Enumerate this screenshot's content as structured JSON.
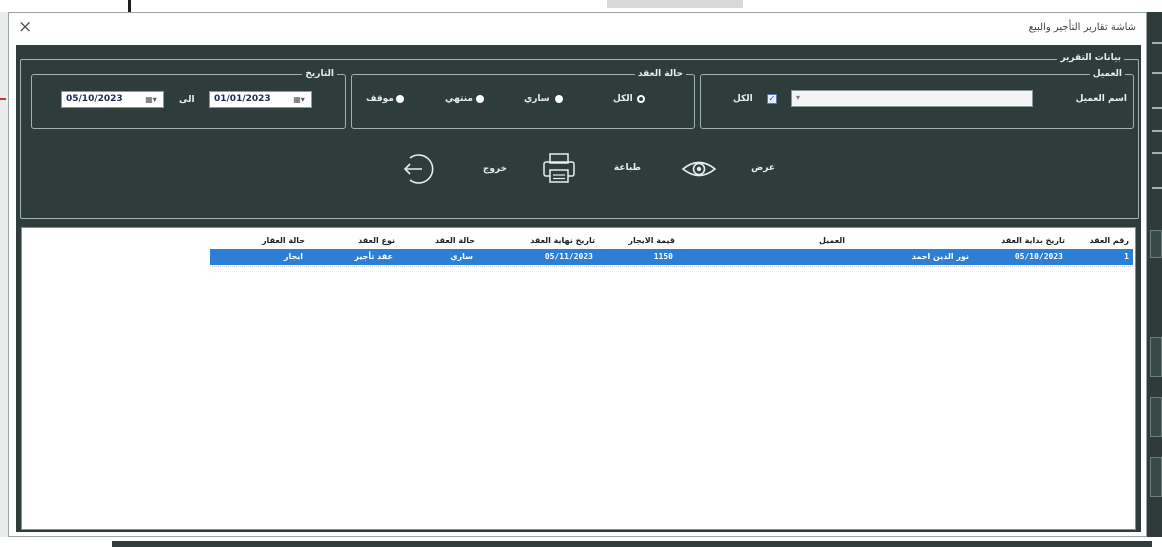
{
  "window": {
    "title": "شاشة تقارير التأجير والبيع",
    "close_glyph": "×"
  },
  "report_panel": {
    "legend": "بيانات التقرير",
    "client": {
      "legend": "العميل",
      "name_label": "اسم العميل",
      "all_label": "الكل",
      "all_checked": true,
      "check_glyph": "✓",
      "input_value": "",
      "input_caret": "▾"
    },
    "contract_status": {
      "legend": "حالة العقد",
      "options": [
        {
          "label": "الكل",
          "selected": true
        },
        {
          "label": "ساري",
          "selected": false
        },
        {
          "label": "منتهي",
          "selected": false
        },
        {
          "label": "موقف",
          "selected": false
        }
      ]
    },
    "date": {
      "legend": "التاريخ",
      "from_value": "01/01/2023",
      "to_label": "الى",
      "to_value": "05/10/2023",
      "picker_glyph": "▦▾"
    }
  },
  "actions": {
    "view_label": "عرض",
    "print_label": "طباعة",
    "exit_label": "خروج"
  },
  "grid": {
    "columns": [
      "رقم العقد",
      "تاريخ بداية العقد",
      "العميل",
      "قيمة الايجار",
      "تاريخ نهاية العقد",
      "حالة العقد",
      "نوع العقد",
      "حالة العقار"
    ],
    "rows": [
      {
        "contract_no": "1",
        "start_date": "05/10/2023",
        "client": "نور الدين احمد",
        "rent_value": "1150",
        "end_date": "05/11/2023",
        "contract_status": "ساري",
        "contract_type": "عقد تأجير",
        "property_status": "ايجار"
      }
    ]
  },
  "colors": {
    "panel_bg": "#2e3d3c",
    "selected_row": "#2d7fd6",
    "frame_border": "#9fb2ae"
  },
  "icons": {
    "view": "eye-icon",
    "print": "printer-icon",
    "exit": "exit-icon"
  }
}
